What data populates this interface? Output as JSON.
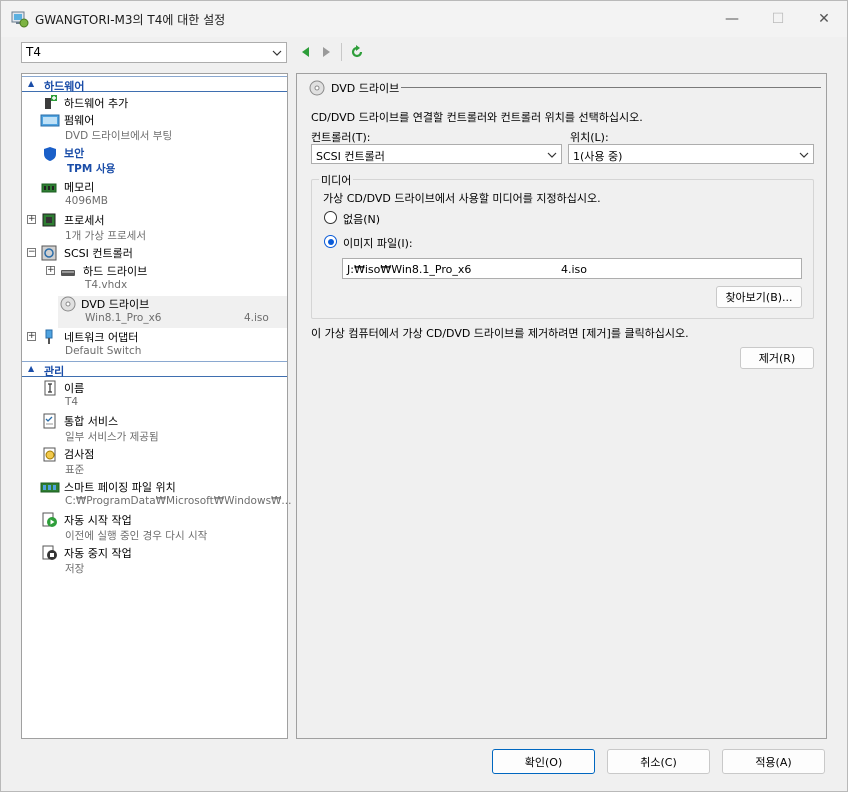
{
  "window": {
    "title": "GWANGTORI-M3의 T4에 대한 설정",
    "minimize": "—",
    "maximize": "☐",
    "close": "✕"
  },
  "vm_select": {
    "value": "T4"
  },
  "tree": {
    "hardware_section": "하드웨어",
    "management_section": "관리",
    "items": [
      {
        "label": "하드웨어 추가",
        "sub": ""
      },
      {
        "label": "펌웨어",
        "sub": "DVD 드라이브에서 부팅"
      },
      {
        "label": "보안",
        "sub": "TPM 사용"
      },
      {
        "label": "메모리",
        "sub": "4096MB"
      },
      {
        "label": "프로세서",
        "sub": "1개 가상 프로세서"
      },
      {
        "label": "SCSI 컨트롤러",
        "sub": ""
      },
      {
        "label": "하드 드라이브",
        "sub": "T4.vhdx"
      },
      {
        "label": "DVD 드라이브",
        "sub": "Win8.1_Pro_x6",
        "sub_tail": "4.iso"
      },
      {
        "label": "네트워크 어댑터",
        "sub": "Default Switch"
      },
      {
        "label": "이름",
        "sub": "T4"
      },
      {
        "label": "통합 서비스",
        "sub": "일부 서비스가 제공됨"
      },
      {
        "label": "검사점",
        "sub": "표준"
      },
      {
        "label": "스마트 페이징 파일 위치",
        "sub": "C:₩ProgramData₩Microsoft₩Windows₩..."
      },
      {
        "label": "자동 시작 작업",
        "sub": "이전에 실행 중인 경우 다시 시작"
      },
      {
        "label": "자동 중지 작업",
        "sub": "저장"
      }
    ]
  },
  "panel": {
    "title": "DVD 드라이브",
    "description": "CD/DVD 드라이브를 연결할 컨트롤러와 컨트롤러 위치를 선택하십시오.",
    "controller_label": "컨트롤러(T):",
    "controller_value": "SCSI 컨트롤러",
    "location_label": "위치(L):",
    "location_value": "1(사용 중)",
    "media_group": "미디어",
    "media_description": "가상 CD/DVD 드라이브에서 사용할 미디어를 지정하십시오.",
    "none_option": "없음(N)",
    "image_option": "이미지 파일(I):",
    "image_path_start": "J:₩iso₩Win8.1_Pro_x6",
    "image_path_end": "4.iso",
    "browse_button": "찾아보기(B)...",
    "remove_description": "이 가상 컴퓨터에서 가상 CD/DVD 드라이브를 제거하려면 [제거]를 클릭하십시오.",
    "remove_button": "제거(R)"
  },
  "footer": {
    "ok": "확인(O)",
    "cancel": "취소(C)",
    "apply": "적용(A)"
  },
  "colors": {
    "accent": "#0067c0",
    "section_text": "#1a4da8",
    "radio": "#0a5bd8"
  }
}
